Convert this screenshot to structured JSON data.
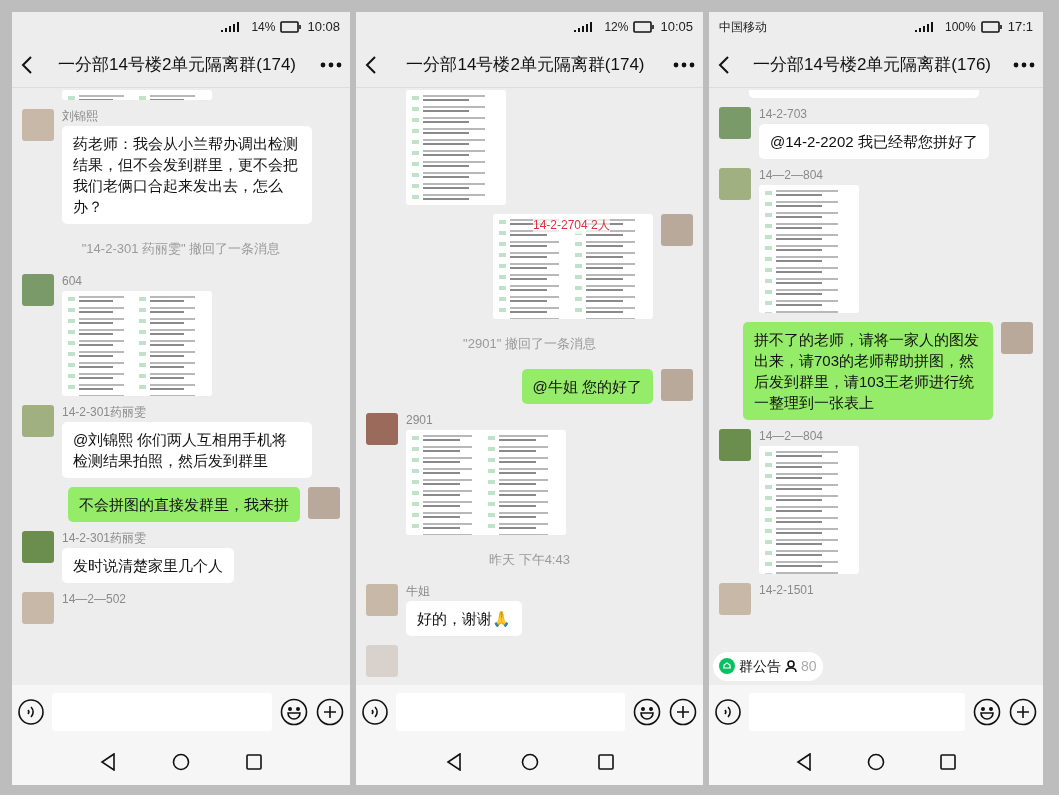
{
  "phones": [
    {
      "status_bar": {
        "battery": "14%",
        "time": "10:08"
      },
      "title": "一分部14号楼2单元隔离群(174)",
      "messages": [
        {
          "kind": "wide_image",
          "outgoing": false,
          "partial": true
        },
        {
          "kind": "text",
          "outgoing": false,
          "sender": "刘锦熙",
          "text": "药老师：我会从小兰帮办调出检测结果，但不会发到群里，更不会把我们老俩口合起来发出去，怎么办？"
        },
        {
          "kind": "recall",
          "text": "\"14-2-301 药丽雯\" 撤回了一条消息"
        },
        {
          "kind": "wide_image",
          "outgoing": false,
          "partial": false,
          "sender": "604"
        },
        {
          "kind": "text",
          "outgoing": false,
          "sender": "14-2-301药丽雯",
          "text": "@刘锦熙  你们两人互相用手机将检测结果拍照，然后发到群里"
        },
        {
          "kind": "text",
          "outgoing": true,
          "text": "不会拼图的直接发群里，我来拼"
        },
        {
          "kind": "text",
          "outgoing": false,
          "sender": "14-2-301药丽雯",
          "text": "发时说清楚家里几个人"
        },
        {
          "kind": "stub",
          "outgoing": false,
          "sender": "14—2—502"
        }
      ]
    },
    {
      "status_bar": {
        "battery": "12%",
        "time": "10:05"
      },
      "title": "一分部14号楼2单元隔离群(174)",
      "messages": [
        {
          "kind": "tall_image",
          "outgoing": false,
          "partial": true
        },
        {
          "kind": "wide_image",
          "outgoing": true,
          "partial": false,
          "overlay_text": "14-2-2704  2人"
        },
        {
          "kind": "recall",
          "text": "\"2901\" 撤回了一条消息"
        },
        {
          "kind": "text",
          "outgoing": true,
          "text": "@牛姐  您的好了"
        },
        {
          "kind": "wide_image",
          "outgoing": false,
          "partial": false,
          "sender": "2901"
        },
        {
          "kind": "time",
          "text": "昨天 下午4:43"
        },
        {
          "kind": "text",
          "outgoing": false,
          "sender": "牛姐",
          "text": "好的，谢谢🙏"
        },
        {
          "kind": "stub",
          "outgoing": false
        }
      ]
    },
    {
      "status_bar": {
        "carrier": "中国移动",
        "battery": "100%",
        "time": "17:1"
      },
      "title": "一分部14号楼2单元隔离群(176)",
      "messages": [
        {
          "kind": "bubble_end",
          "outgoing": false
        },
        {
          "kind": "text",
          "outgoing": false,
          "sender": "14-2-703",
          "text": "@14-2-2202  我已经帮您拼好了"
        },
        {
          "kind": "tall_image",
          "outgoing": false,
          "partial": false,
          "sender": "14—2—804"
        },
        {
          "kind": "text",
          "outgoing": true,
          "text": "拼不了的老师，请将一家人的图发出来，请703的老师帮助拼图，然后发到群里，请103王老师进行统一整理到一张表上"
        },
        {
          "kind": "tall_image",
          "outgoing": false,
          "partial": false,
          "sender": "14—2—804"
        },
        {
          "kind": "stub",
          "outgoing": false,
          "sender": "14-2-1501"
        }
      ],
      "notice": {
        "label": "群公告",
        "count": "80"
      }
    }
  ]
}
